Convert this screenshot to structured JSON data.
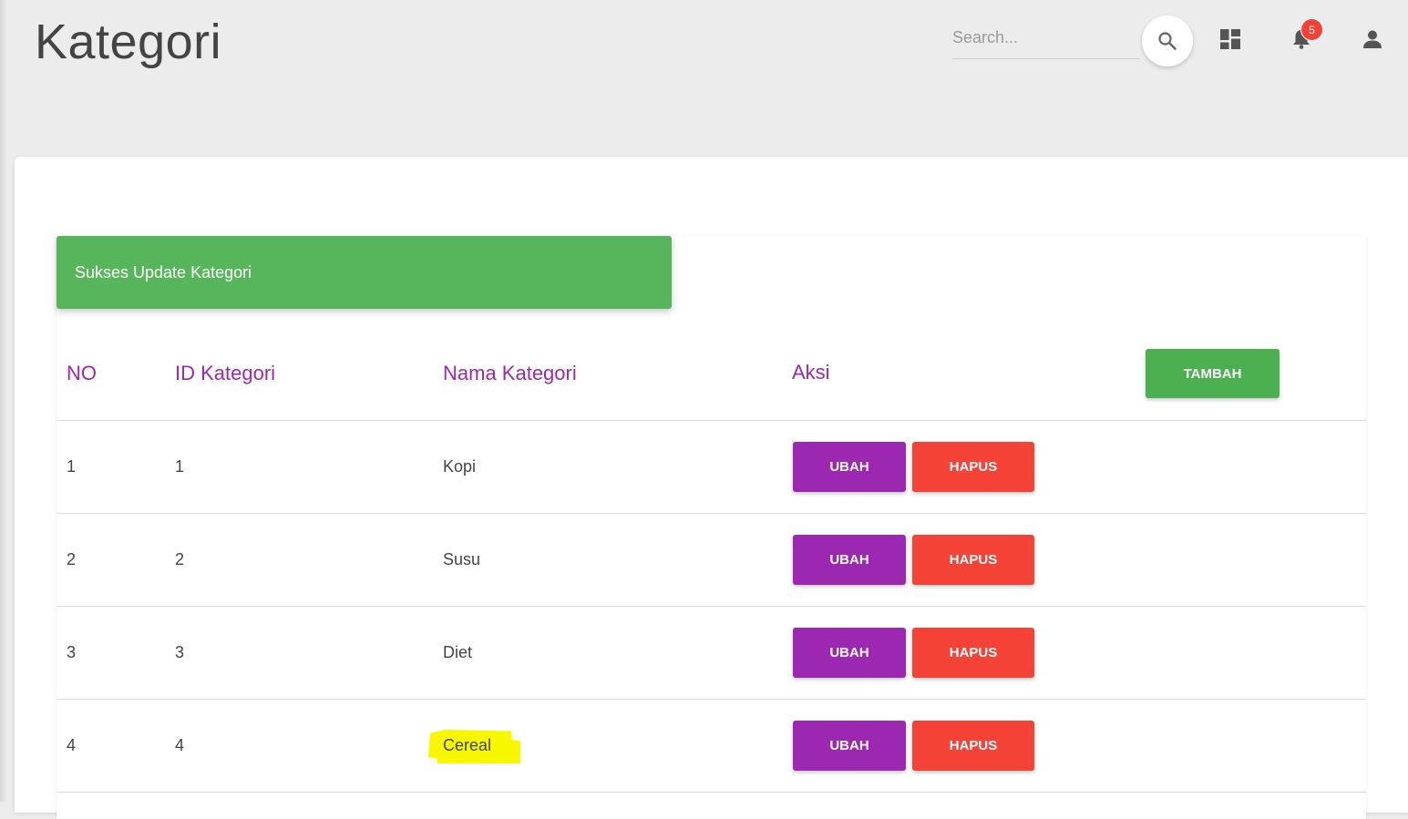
{
  "header": {
    "title": "Kategori",
    "search_placeholder": "Search...",
    "notification_count": "5"
  },
  "alert": {
    "message": "Sukses Update Kategori"
  },
  "table": {
    "columns": [
      "NO",
      "ID Kategori",
      "Nama Kategori",
      "Aksi"
    ],
    "add_label": "TAMBAH",
    "edit_label": "UBAH",
    "delete_label": "HAPUS",
    "rows": [
      {
        "no": "1",
        "id": "1",
        "name": "Kopi"
      },
      {
        "no": "2",
        "id": "2",
        "name": "Susu"
      },
      {
        "no": "3",
        "id": "3",
        "name": "Diet"
      },
      {
        "no": "4",
        "id": "4",
        "name": "Cereal"
      }
    ]
  },
  "icons": {
    "search": "search-icon",
    "dashboard": "dashboard-icon",
    "notifications": "bell-icon",
    "account": "person-icon"
  },
  "colors": {
    "primary": "#9c27b0",
    "success": "#4caf50",
    "alert_success": "#57b65b",
    "danger": "#f44336",
    "highlight": "#f7f700"
  }
}
